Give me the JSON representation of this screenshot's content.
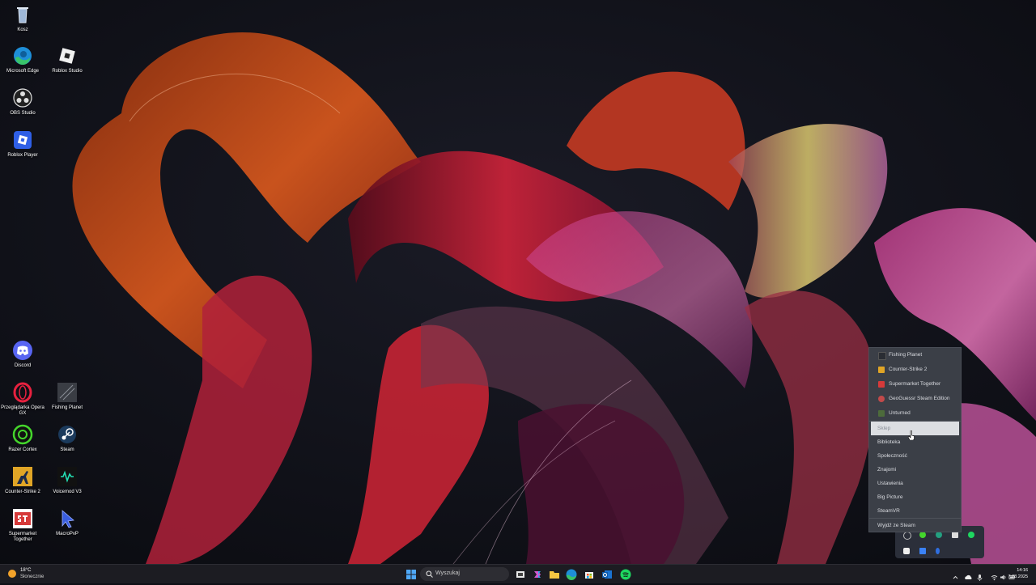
{
  "desktop_icons": [
    {
      "label": "Kosz",
      "icon": "recycle-bin-icon"
    },
    {
      "label": "Microsoft Edge",
      "icon": "edge-icon"
    },
    {
      "label": "Roblox Studio",
      "icon": "roblox-studio-icon"
    },
    {
      "label": "OBS Studio",
      "icon": "obs-icon"
    },
    {
      "label": "Roblox Player",
      "icon": "roblox-player-icon"
    },
    {
      "label": "Discord",
      "icon": "discord-icon"
    },
    {
      "label": "Przeglądarka Opera GX",
      "icon": "opera-gx-icon"
    },
    {
      "label": "Fishing Planet",
      "icon": "fishing-planet-icon"
    },
    {
      "label": "Razer Cortex",
      "icon": "razer-cortex-icon"
    },
    {
      "label": "Steam",
      "icon": "steam-icon"
    },
    {
      "label": "Counter-Strike 2",
      "icon": "counter-strike-icon"
    },
    {
      "label": "Voicemod V3",
      "icon": "voicemod-icon"
    },
    {
      "label": "Supermarket Together",
      "icon": "supermarket-together-icon"
    },
    {
      "label": "MacroPvP",
      "icon": "cursor-icon"
    }
  ],
  "steam_menu": {
    "recent_games": [
      {
        "label": "Fishing Planet",
        "color": "#2a2d33"
      },
      {
        "label": "Counter-Strike 2",
        "color": "#e0a526"
      },
      {
        "label": "Supermarket Together",
        "color": "#d63a3a"
      },
      {
        "label": "GeoGuessr Steam Edition",
        "color": "#c24a4a"
      },
      {
        "label": "Unturned",
        "color": "#4d6b3b"
      }
    ],
    "items": [
      "Sklep",
      "Biblioteka",
      "Społeczność",
      "Znajomi",
      "Ustawienia",
      "Big Picture",
      "SteamVR",
      "Wyjdź ze Steam"
    ],
    "highlighted": "Sklep"
  },
  "taskbar": {
    "weather": {
      "temp": "18°C",
      "condition": "Słonecznie"
    },
    "search_placeholder": "Wyszukaj",
    "clock": {
      "time": "14:16",
      "date": "7.08.2025"
    }
  },
  "colors": {
    "taskbar_bg": "#1c1c22",
    "menu_bg": "#3b3f47",
    "accent": "#3b82f6"
  }
}
